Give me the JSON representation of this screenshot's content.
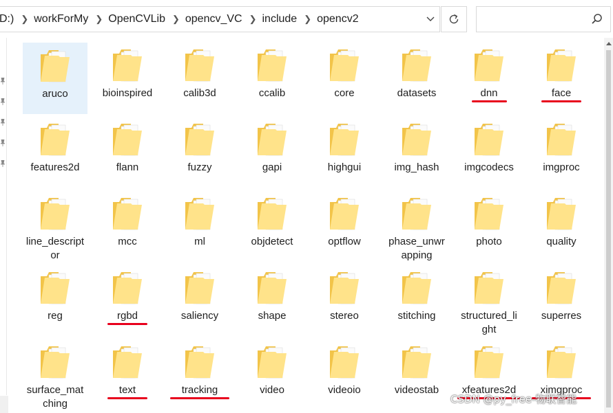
{
  "address_bar": {
    "crumbs": [
      "D:)",
      "workForMy",
      "OpenCVLib",
      "opencv_VC",
      "include",
      "opencv2"
    ]
  },
  "search": {
    "placeholder": ""
  },
  "icons": {
    "folder": "folder-icon",
    "refresh": "refresh-icon",
    "search": "search-icon",
    "dropdown": "chevron-down-icon",
    "pin": "pin-icon",
    "scroll_up": "chevron-up-icon"
  },
  "colors": {
    "folder_light": "#ffe38a",
    "folder_dark": "#f2c449",
    "selection": "#e5f1fb",
    "annotation_red": "#e8001c"
  },
  "folders": [
    {
      "label": "aruco",
      "selected": true
    },
    {
      "label": "bioinspired"
    },
    {
      "label": "calib3d"
    },
    {
      "label": "ccalib"
    },
    {
      "label": "core"
    },
    {
      "label": "datasets"
    },
    {
      "label": "dnn",
      "underlined": true
    },
    {
      "label": "face",
      "underlined": true
    },
    {
      "label": "features2d"
    },
    {
      "label": "flann"
    },
    {
      "label": "fuzzy"
    },
    {
      "label": "gapi"
    },
    {
      "label": "highgui"
    },
    {
      "label": "img_hash"
    },
    {
      "label": "imgcodecs"
    },
    {
      "label": "imgproc"
    },
    {
      "label": "line_descriptor"
    },
    {
      "label": "mcc"
    },
    {
      "label": "ml"
    },
    {
      "label": "objdetect"
    },
    {
      "label": "optflow"
    },
    {
      "label": "phase_unwrapping"
    },
    {
      "label": "photo"
    },
    {
      "label": "quality"
    },
    {
      "label": "reg"
    },
    {
      "label": "rgbd",
      "underlined": true
    },
    {
      "label": "saliency"
    },
    {
      "label": "shape"
    },
    {
      "label": "stereo"
    },
    {
      "label": "stitching"
    },
    {
      "label": "structured_light"
    },
    {
      "label": "superres"
    },
    {
      "label": "surface_matching"
    },
    {
      "label": "text",
      "underlined": true
    },
    {
      "label": "tracking",
      "underlined": true
    },
    {
      "label": "video"
    },
    {
      "label": "videoio"
    },
    {
      "label": "videostab"
    },
    {
      "label": "xfeatures2d",
      "underlined": true
    },
    {
      "label": "ximgproc",
      "underlined": true
    }
  ],
  "watermark": "CSDN @py_free-物联智能"
}
